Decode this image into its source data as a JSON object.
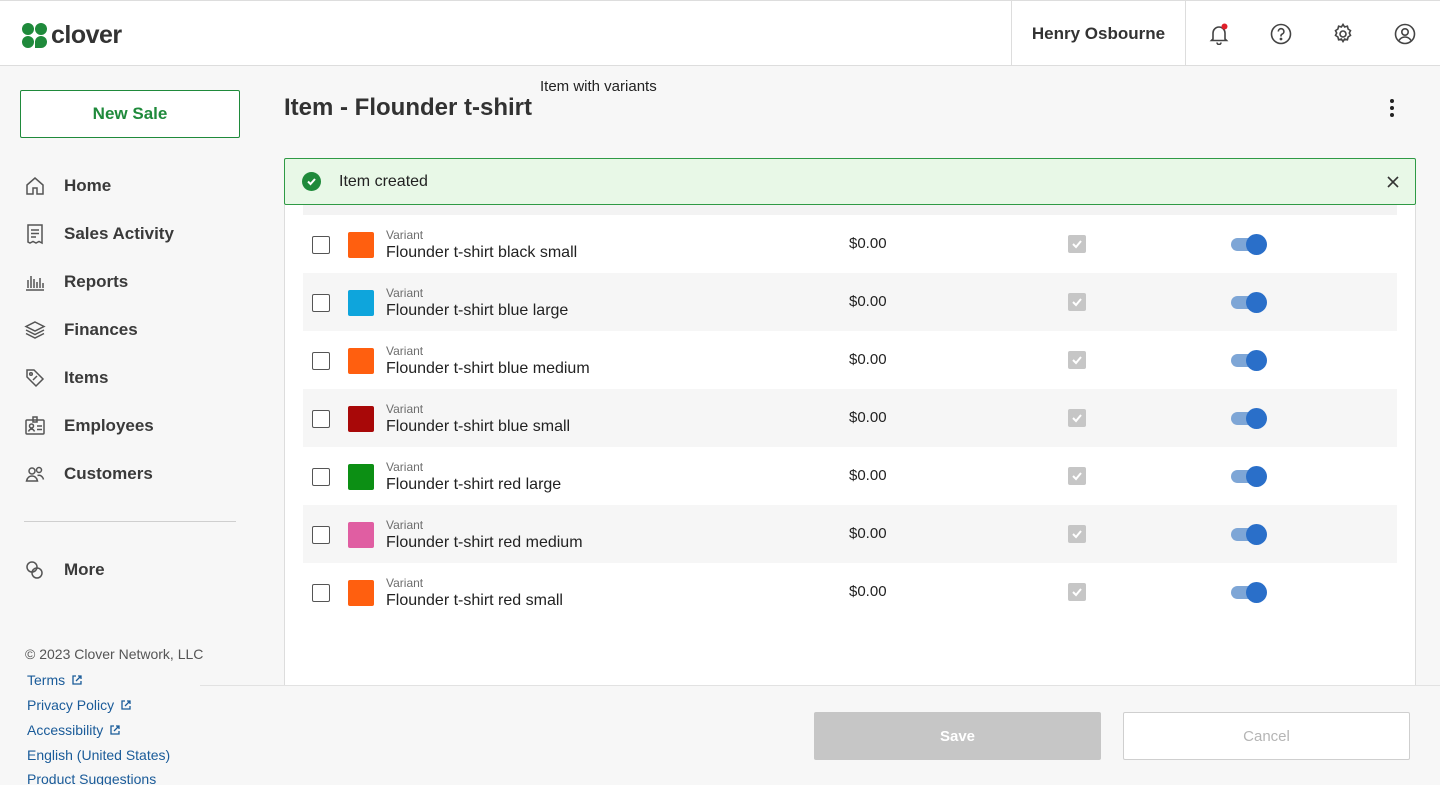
{
  "header": {
    "logo_text": "clover",
    "user_name": "Henry Osbourne",
    "icons": [
      "bell-icon",
      "help-icon",
      "gear-icon",
      "user-circle-icon"
    ],
    "notification_dot_color": "#e0202a"
  },
  "sidebar": {
    "new_sale_label": "New Sale",
    "items": [
      {
        "label": "Home",
        "icon": "home-icon"
      },
      {
        "label": "Sales Activity",
        "icon": "receipt-icon"
      },
      {
        "label": "Reports",
        "icon": "bar-chart-icon"
      },
      {
        "label": "Finances",
        "icon": "layers-icon"
      },
      {
        "label": "Items",
        "icon": "tags-icon"
      },
      {
        "label": "Employees",
        "icon": "id-badge-icon"
      },
      {
        "label": "Customers",
        "icon": "people-icon"
      }
    ],
    "more_label": "More",
    "copyright": "© 2023 Clover Network, LLC",
    "links": [
      "Terms",
      "Privacy Policy",
      "Accessibility",
      "English (United States)",
      "Product Suggestions"
    ]
  },
  "main": {
    "tooltip": "Item with variants",
    "title": "Item - Flounder t-shirt",
    "banner_text": "Item created",
    "variant_label": "Variant",
    "variants": [
      {
        "name": "Flounder t-shirt black small",
        "price": "$0.00",
        "color": "#ff5f0f"
      },
      {
        "name": "Flounder t-shirt blue large",
        "price": "$0.00",
        "color": "#0ea5dc"
      },
      {
        "name": "Flounder t-shirt blue medium",
        "price": "$0.00",
        "color": "#ff5f0f"
      },
      {
        "name": "Flounder t-shirt blue small",
        "price": "$0.00",
        "color": "#a80808"
      },
      {
        "name": "Flounder t-shirt red large",
        "price": "$0.00",
        "color": "#0c8f14"
      },
      {
        "name": "Flounder t-shirt red medium",
        "price": "$0.00",
        "color": "#e05ea2"
      },
      {
        "name": "Flounder t-shirt red small",
        "price": "$0.00",
        "color": "#ff5f0f"
      }
    ]
  },
  "footer": {
    "save_label": "Save",
    "cancel_label": "Cancel"
  },
  "colors": {
    "brand_green": "#1f8a3b",
    "link_blue": "#1a5b99",
    "toggle_blue": "#2a6fc9"
  }
}
